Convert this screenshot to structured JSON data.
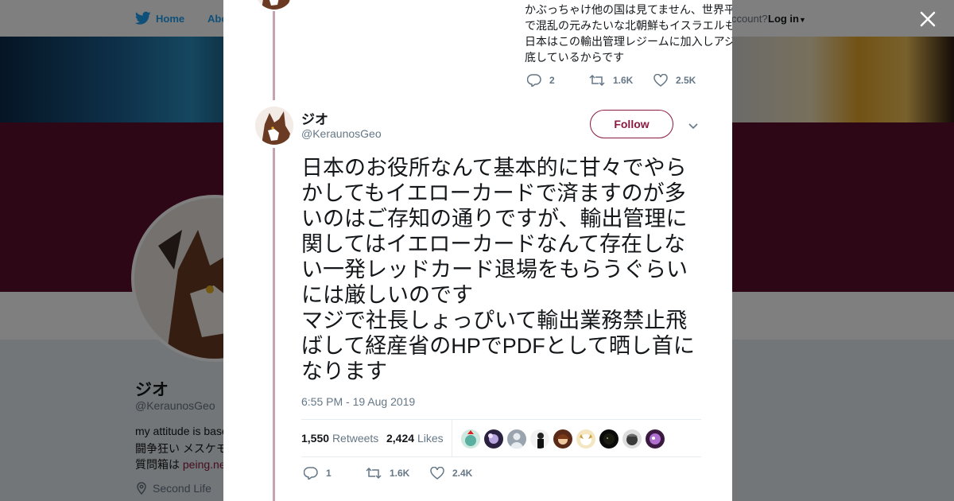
{
  "topnav": {
    "home_label": "Home",
    "about_label": "Abo",
    "account_text": "ccount?",
    "login_label": "Log in"
  },
  "profile": {
    "name": "ジオ",
    "handle": "@KeraunosGeo",
    "bio_line1": "my attitude is base",
    "bio_line2": "闘争狂い メスケモ",
    "bio_line3_prefix": "質問箱は ",
    "bio_line3_link": "peing.ne",
    "location": "Second Life"
  },
  "previous_tweet": {
    "text_lines": [
      "かぶっちゃけ他の国は見てません、世界平和なんて言うだけなら存在するだけ",
      "で混乱の元みたいな北朝鮮もイスラエルも名乗ってます",
      "日本はこの輸出管理レジームに加入しアジアの中で特に厳しい管理と刑罰を徹",
      "底しているからです"
    ],
    "replies": "2",
    "retweets": "1.6K",
    "likes": "2.5K"
  },
  "tweet": {
    "name": "ジオ",
    "handle": "@KeraunosGeo",
    "follow_label": "Follow",
    "text": "日本のお役所なんて基本的に甘々でやらかしてもイエローカードで済ますのが多いのはご存知の通りですが、輸出管理に関してはイエローカードなんて存在しない一発レッドカード退場をもらうぐらいには厳しいのです\nマジで社長しょっぴいて輸出業務禁止飛ばして経産省のHPでPDFとして晒し首になります",
    "timestamp": "6:55 PM - 19 Aug 2019",
    "retweet_count": "1,550",
    "retweet_label": "Retweets",
    "like_count": "2,424",
    "like_label": "Likes",
    "replies": "1",
    "retweets": "1.6K",
    "likes": "2.4K"
  },
  "colors": {
    "accent": "#8b1a3f",
    "banner_maroon": "#5c0e2c",
    "twitter_blue": "#1da1f2"
  },
  "icons": [
    "twitter-bird-icon",
    "close-icon",
    "reply-icon",
    "retweet-icon",
    "like-icon",
    "chevron-down-icon",
    "location-pin-icon"
  ]
}
